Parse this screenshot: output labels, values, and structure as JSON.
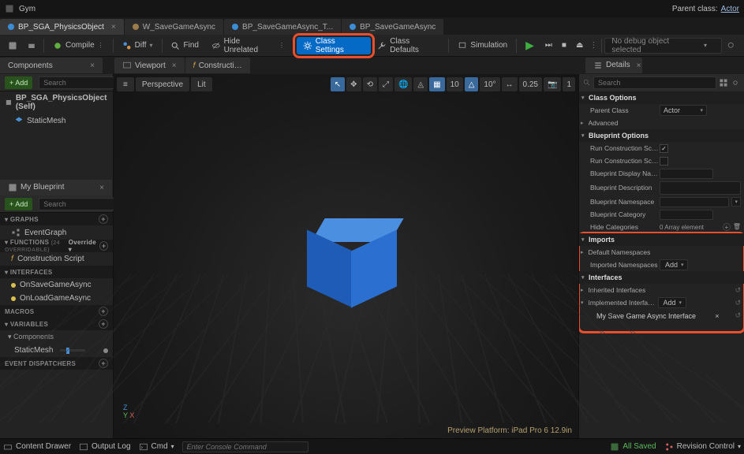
{
  "topbar": {
    "title": "Gym",
    "parent_class_label": "Parent class:",
    "parent_class_value": "Actor"
  },
  "tabs": [
    {
      "label": "BP_SGA_PhysicsObject",
      "color": "blue",
      "active": true
    },
    {
      "label": "W_SaveGameAsync",
      "color": "brown",
      "active": false
    },
    {
      "label": "BP_SaveGameAsync_T...",
      "color": "blue",
      "active": false
    },
    {
      "label": "BP_SaveGameAsync",
      "color": "blue",
      "active": false
    }
  ],
  "toolbar": {
    "compile": "Compile",
    "diff": "Diff",
    "find": "Find",
    "hide_unrelated": "Hide Unrelated",
    "class_settings": "Class Settings",
    "class_defaults": "Class Defaults",
    "simulation": "Simulation",
    "debug_select": "No debug object selected"
  },
  "panel_tabs": {
    "components": "Components",
    "viewport": "Viewport",
    "construction": "Constructi…",
    "details": "Details"
  },
  "components_panel": {
    "add": "Add",
    "search_placeholder": "Search",
    "tree": [
      {
        "label": "BP_SGA_PhysicsObject (Self)",
        "root": true
      },
      {
        "label": "StaticMesh",
        "root": false
      }
    ]
  },
  "myblueprint": {
    "title": "My Blueprint",
    "add": "Add",
    "search_placeholder": "Search",
    "sections": {
      "graphs": "GRAPHS",
      "functions": "FUNCTIONS",
      "functions_note": "(24 OVERRIDABLE)",
      "override": "Override",
      "interfaces": "INTERFACES",
      "macros": "MACROS",
      "variables": "VARIABLES",
      "components_sub": "Components",
      "event_dispatchers": "EVENT DISPATCHERS"
    },
    "items": {
      "event_graph": "EventGraph",
      "construction_script": "Construction Script",
      "on_save": "OnSaveGameAsync",
      "on_load": "OnLoadGameAsync",
      "static_mesh": "StaticMesh"
    }
  },
  "viewport": {
    "menu": "≡",
    "perspective": "Perspective",
    "lit": "Lit",
    "snap_angle": "10",
    "snap_rot": "10°",
    "snap_scale": "0.25",
    "cam_speed": "1",
    "preview": "Preview Platform:  iPad Pro 6 12.9in"
  },
  "details": {
    "search_placeholder": "Search",
    "cats": {
      "class_options": "Class Options",
      "blueprint_options": "Blueprint Options",
      "imports": "Imports",
      "interfaces": "Interfaces"
    },
    "props": {
      "parent_class": "Parent Class",
      "parent_class_val": "Actor",
      "advanced": "Advanced",
      "run_construction_on": "Run Construction Script on...",
      "run_construction_in": "Run Construction Script in...",
      "bp_display_name": "Blueprint Display Name",
      "bp_description": "Blueprint Description",
      "bp_namespace": "Blueprint Namespace",
      "bp_category": "Blueprint Category",
      "hide_categories": "Hide Categories",
      "hide_categories_val": "0 Array element",
      "default_namespaces": "Default Namespaces",
      "imported_namespaces": "Imported Namespaces",
      "inherited_interfaces": "Inherited Interfaces",
      "implemented_interfaces": "Implemented Interfaces",
      "add": "Add",
      "iface_name": "My Save Game Async Interface"
    }
  },
  "bottombar": {
    "content_drawer": "Content Drawer",
    "output_log": "Output Log",
    "cmd": "Cmd",
    "cmd_placeholder": "Enter Console Command",
    "all_saved": "All Saved",
    "revision": "Revision Control"
  }
}
